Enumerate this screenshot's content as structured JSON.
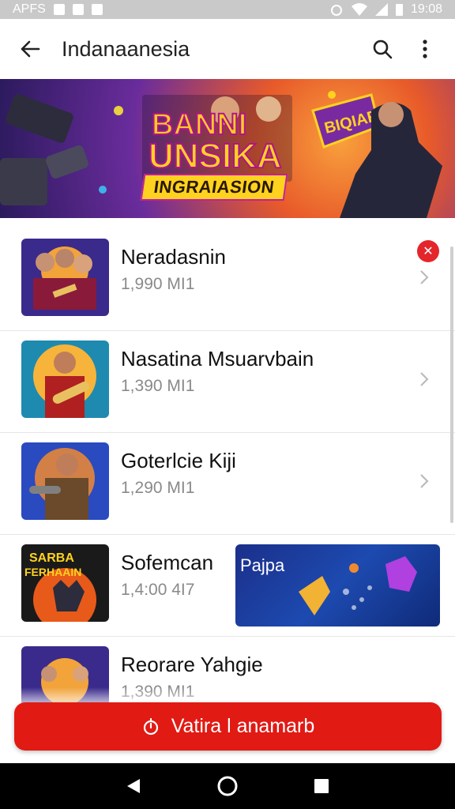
{
  "status_bar": {
    "left_text": "APFS",
    "time": "19:08"
  },
  "app_bar": {
    "title": "Indanaanesia"
  },
  "banner": {
    "title": "BANNI UNSIKA",
    "subtitle": "INGRAIASION",
    "tag": "BIQIAR"
  },
  "list": {
    "items": [
      {
        "title": "Neradasnin",
        "subtitle": "1,990 MI1",
        "badge": "✕"
      },
      {
        "title": "Nasatina Msuarvbain",
        "subtitle": "1,390 MI1"
      },
      {
        "title": "Goterlcie Kiji",
        "subtitle": "1,290 MI1"
      },
      {
        "title": "Sofemcan",
        "subtitle": "1,4:00 4I7",
        "thumb_text": "SARBA FERHAAIN",
        "promo_label": "Pajpa"
      },
      {
        "title": "Reorare Yahgie",
        "subtitle": "1,390 MI1"
      }
    ]
  },
  "cta": {
    "label": "Vatira l anamarb"
  },
  "colors": {
    "accent": "#e11a14",
    "badge": "#e4262b"
  }
}
